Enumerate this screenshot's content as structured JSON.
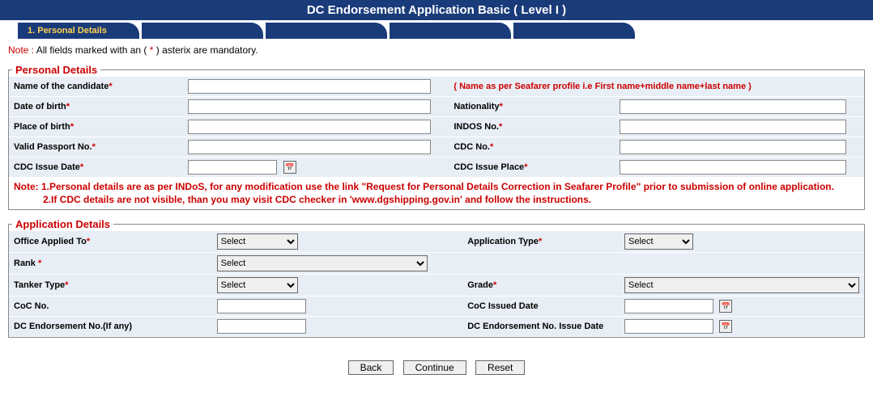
{
  "header": {
    "title": "DC Endorsement Application Basic ( Level I )"
  },
  "tabs": [
    {
      "label": "1. Personal Details",
      "active": true
    },
    {
      "label": "",
      "active": false
    },
    {
      "label": "",
      "active": false
    },
    {
      "label": "",
      "active": false
    },
    {
      "label": "",
      "active": false
    }
  ],
  "mandatory_note": {
    "prefix": "Note :",
    "text": " All fields marked with an ( ",
    "star": "*",
    "suffix": " ) asterix are mandatory."
  },
  "personal": {
    "legend": "Personal Details",
    "name_label": "Name of the candidate",
    "name_value": "",
    "name_hint": "( Name as per Seafarer profile i.e First name+middle name+last name )",
    "dob_label": "Date of birth",
    "dob_value": "",
    "nationality_label": "Nationality",
    "nationality_value": "",
    "pob_label": "Place of birth",
    "pob_value": "",
    "indos_label": "INDOS No.",
    "indos_value": "",
    "passport_label": "Valid Passport No.",
    "passport_value": "",
    "cdcno_label": "CDC No.",
    "cdcno_value": "",
    "cdc_issue_date_label": "CDC Issue Date",
    "cdc_issue_date_value": "",
    "cdc_issue_place_label": "CDC Issue Place",
    "cdc_issue_place_value": "",
    "note_line1": "Note: 1.Personal details are as per INDoS, for any modification use the link \"Request for Personal Details Correction in Seafarer Profile\" prior to submission of online application.",
    "note_line2": "2.If CDC details are not visible, than you may visit CDC checker in 'www.dgshipping.gov.in' and follow the instructions."
  },
  "application": {
    "legend": "Application Details",
    "office_label": "Office Applied To",
    "office_selected": "Select",
    "app_type_label": "Application Type",
    "app_type_selected": "Select",
    "rank_label": "Rank ",
    "rank_selected": "Select",
    "tanker_label": "Tanker Type",
    "tanker_selected": "Select",
    "grade_label": "Grade",
    "grade_selected": "Select",
    "coc_no_label": "CoC No.",
    "coc_no_value": "",
    "coc_date_label": "CoC Issued Date",
    "coc_date_value": "",
    "dcend_no_label": "DC Endorsement No.(If any)",
    "dcend_no_value": "",
    "dcend_date_label": "DC Endorsement No. Issue Date",
    "dcend_date_value": ""
  },
  "buttons": {
    "back": "Back",
    "continue": "Continue",
    "reset": "Reset"
  },
  "icons": {
    "calendar_glyph": "📅"
  }
}
